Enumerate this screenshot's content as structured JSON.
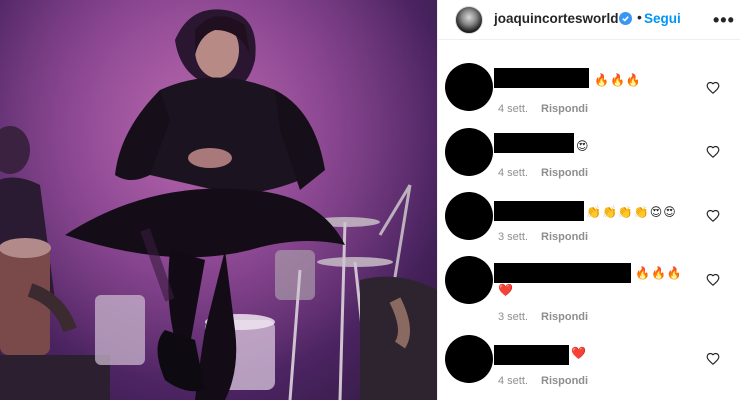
{
  "header": {
    "username": "joaquincortesworld",
    "dot": "•",
    "follow_label": "Segui",
    "more_label": "•••"
  },
  "comments": [
    {
      "emojis": "🔥🔥🔥",
      "time": "4 sett.",
      "reply_label": "Rispondi"
    },
    {
      "emojis": "😍",
      "time": "4 sett.",
      "reply_label": "Rispondi"
    },
    {
      "emojis": "👏👏👏👏😍😍",
      "time": "3 sett.",
      "reply_label": "Rispondi"
    },
    {
      "emojis": "🔥🔥🔥",
      "emojis_line2": "❤️",
      "time": "3 sett.",
      "reply_label": "Rispondi"
    },
    {
      "emojis": "❤️",
      "time": "4 sett.",
      "reply_label": "Rispondi"
    }
  ],
  "colors": {
    "link_blue": "#0095f6",
    "verified_blue": "#3897f0",
    "photo_tint": "#7b3a86",
    "meta_gray": "#8e8e8e"
  },
  "icons": [
    "verified-badge-icon",
    "more-options-icon",
    "heart-icon"
  ]
}
